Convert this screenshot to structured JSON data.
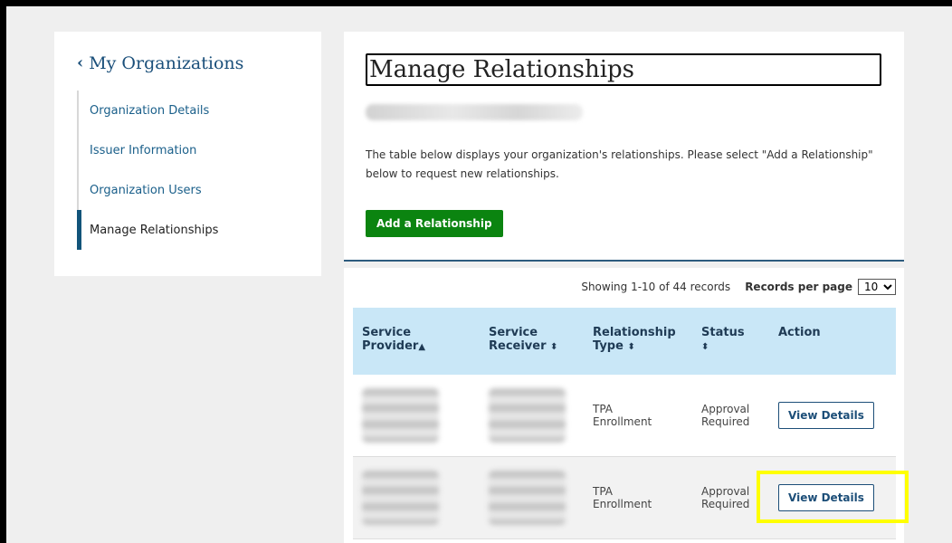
{
  "sidebar": {
    "back_label": "My Organizations",
    "items": [
      {
        "label": "Organization Details"
      },
      {
        "label": "Issuer Information"
      },
      {
        "label": "Organization Users"
      },
      {
        "label": "Manage Relationships"
      }
    ]
  },
  "main": {
    "title": "Manage Relationships",
    "intro": "The table below displays your organization's relationships. Please select \"Add a Relationship\" below to request new relationships.",
    "add_button": "Add a Relationship"
  },
  "table": {
    "showing": "Showing 1-10 of 44 records",
    "records_per_page_label": "Records per page",
    "records_per_page_value": "10",
    "columns": [
      {
        "line1": "Service",
        "line2": "Provider",
        "sort": "▲"
      },
      {
        "line1": "Service",
        "line2": "Receiver",
        "sort": "⬍"
      },
      {
        "line1": "Relationship",
        "line2": "Type",
        "sort": "⬍"
      },
      {
        "line1": "Status",
        "line2": "",
        "sort": "⬍"
      },
      {
        "line1": "Action",
        "line2": "",
        "sort": ""
      }
    ],
    "rows": [
      {
        "type_line1": "TPA",
        "type_line2": "Enrollment",
        "status_line1": "Approval",
        "status_line2": "Required",
        "action": "View Details"
      },
      {
        "type_line1": "TPA",
        "type_line2": "Enrollment",
        "status_line1": "Approval",
        "status_line2": "Required",
        "action": "View Details"
      }
    ]
  },
  "colors": {
    "accent_green": "#0b8410",
    "header_blue": "#c9e7f7",
    "link_blue": "#1a5f8a",
    "highlight": "#ffff00"
  }
}
